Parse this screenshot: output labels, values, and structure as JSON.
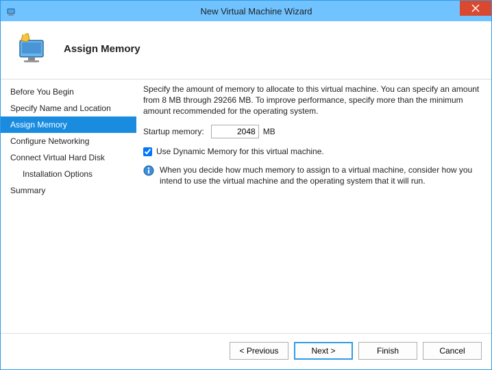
{
  "window": {
    "title": "New Virtual Machine Wizard"
  },
  "header": {
    "heading": "Assign Memory"
  },
  "sidebar": {
    "items": [
      {
        "label": "Before You Begin"
      },
      {
        "label": "Specify Name and Location"
      },
      {
        "label": "Assign Memory"
      },
      {
        "label": "Configure Networking"
      },
      {
        "label": "Connect Virtual Hard Disk"
      },
      {
        "label": "Installation Options"
      },
      {
        "label": "Summary"
      }
    ]
  },
  "content": {
    "description": "Specify the amount of memory to allocate to this virtual machine. You can specify an amount from 8 MB through 29266 MB. To improve performance, specify more than the minimum amount recommended for the operating system.",
    "startup_label": "Startup memory:",
    "startup_value": "2048",
    "startup_unit": "MB",
    "dynmem_label": "Use Dynamic Memory for this virtual machine.",
    "dynmem_checked": true,
    "info_text": "When you decide how much memory to assign to a virtual machine, consider how you intend to use the virtual machine and the operating system that it will run."
  },
  "footer": {
    "previous": "< Previous",
    "next": "Next >",
    "finish": "Finish",
    "cancel": "Cancel"
  }
}
